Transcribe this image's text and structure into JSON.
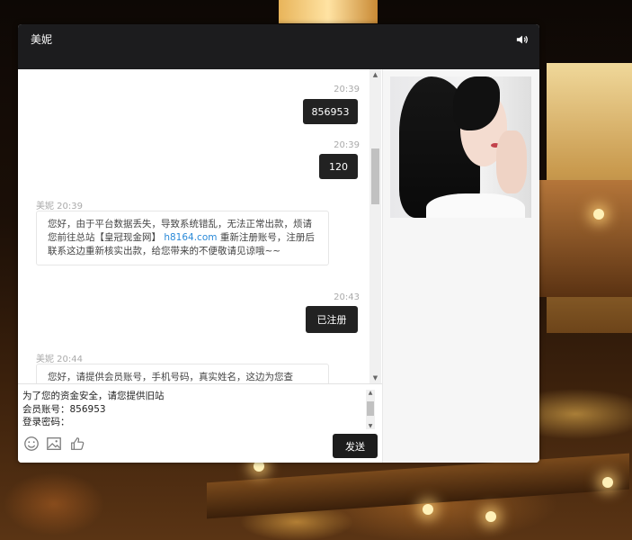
{
  "window": {
    "title": "美妮"
  },
  "messages": [
    {
      "side": "right",
      "time": "20:39",
      "text": "856953"
    },
    {
      "side": "right",
      "time": "20:39",
      "text": "120"
    },
    {
      "side": "left",
      "sender_time": "美妮 20:39",
      "text_before": "您好，由于平台数据丢失，导致系统错乱，无法正常出款，烦请您前往总站【皇冠现金网】",
      "link": "h8164.com",
      "text_after": "重新注册账号，注册后联系这边重新核实出款，给您带来的不便敬请见谅哦~~"
    },
    {
      "side": "right",
      "time": "20:43",
      "text": "已注册"
    },
    {
      "side": "left",
      "sender_time": "美妮 20:44",
      "text_before": "您好，请提供会员账号，手机号码，真实姓名，这边为您查"
    }
  ],
  "composer": {
    "draft": "为了您的资金安全，请您提供旧站\n会员账号：856953\n登录密码：\n取款密码：",
    "send_label": "发送"
  },
  "icons": [
    "speaker-icon",
    "emoji-icon",
    "image-icon",
    "thumbs-up-icon"
  ],
  "colors": {
    "titlebar": "#1c1c1e",
    "bubble_dark": "#222222",
    "link": "#2b8ad8"
  }
}
